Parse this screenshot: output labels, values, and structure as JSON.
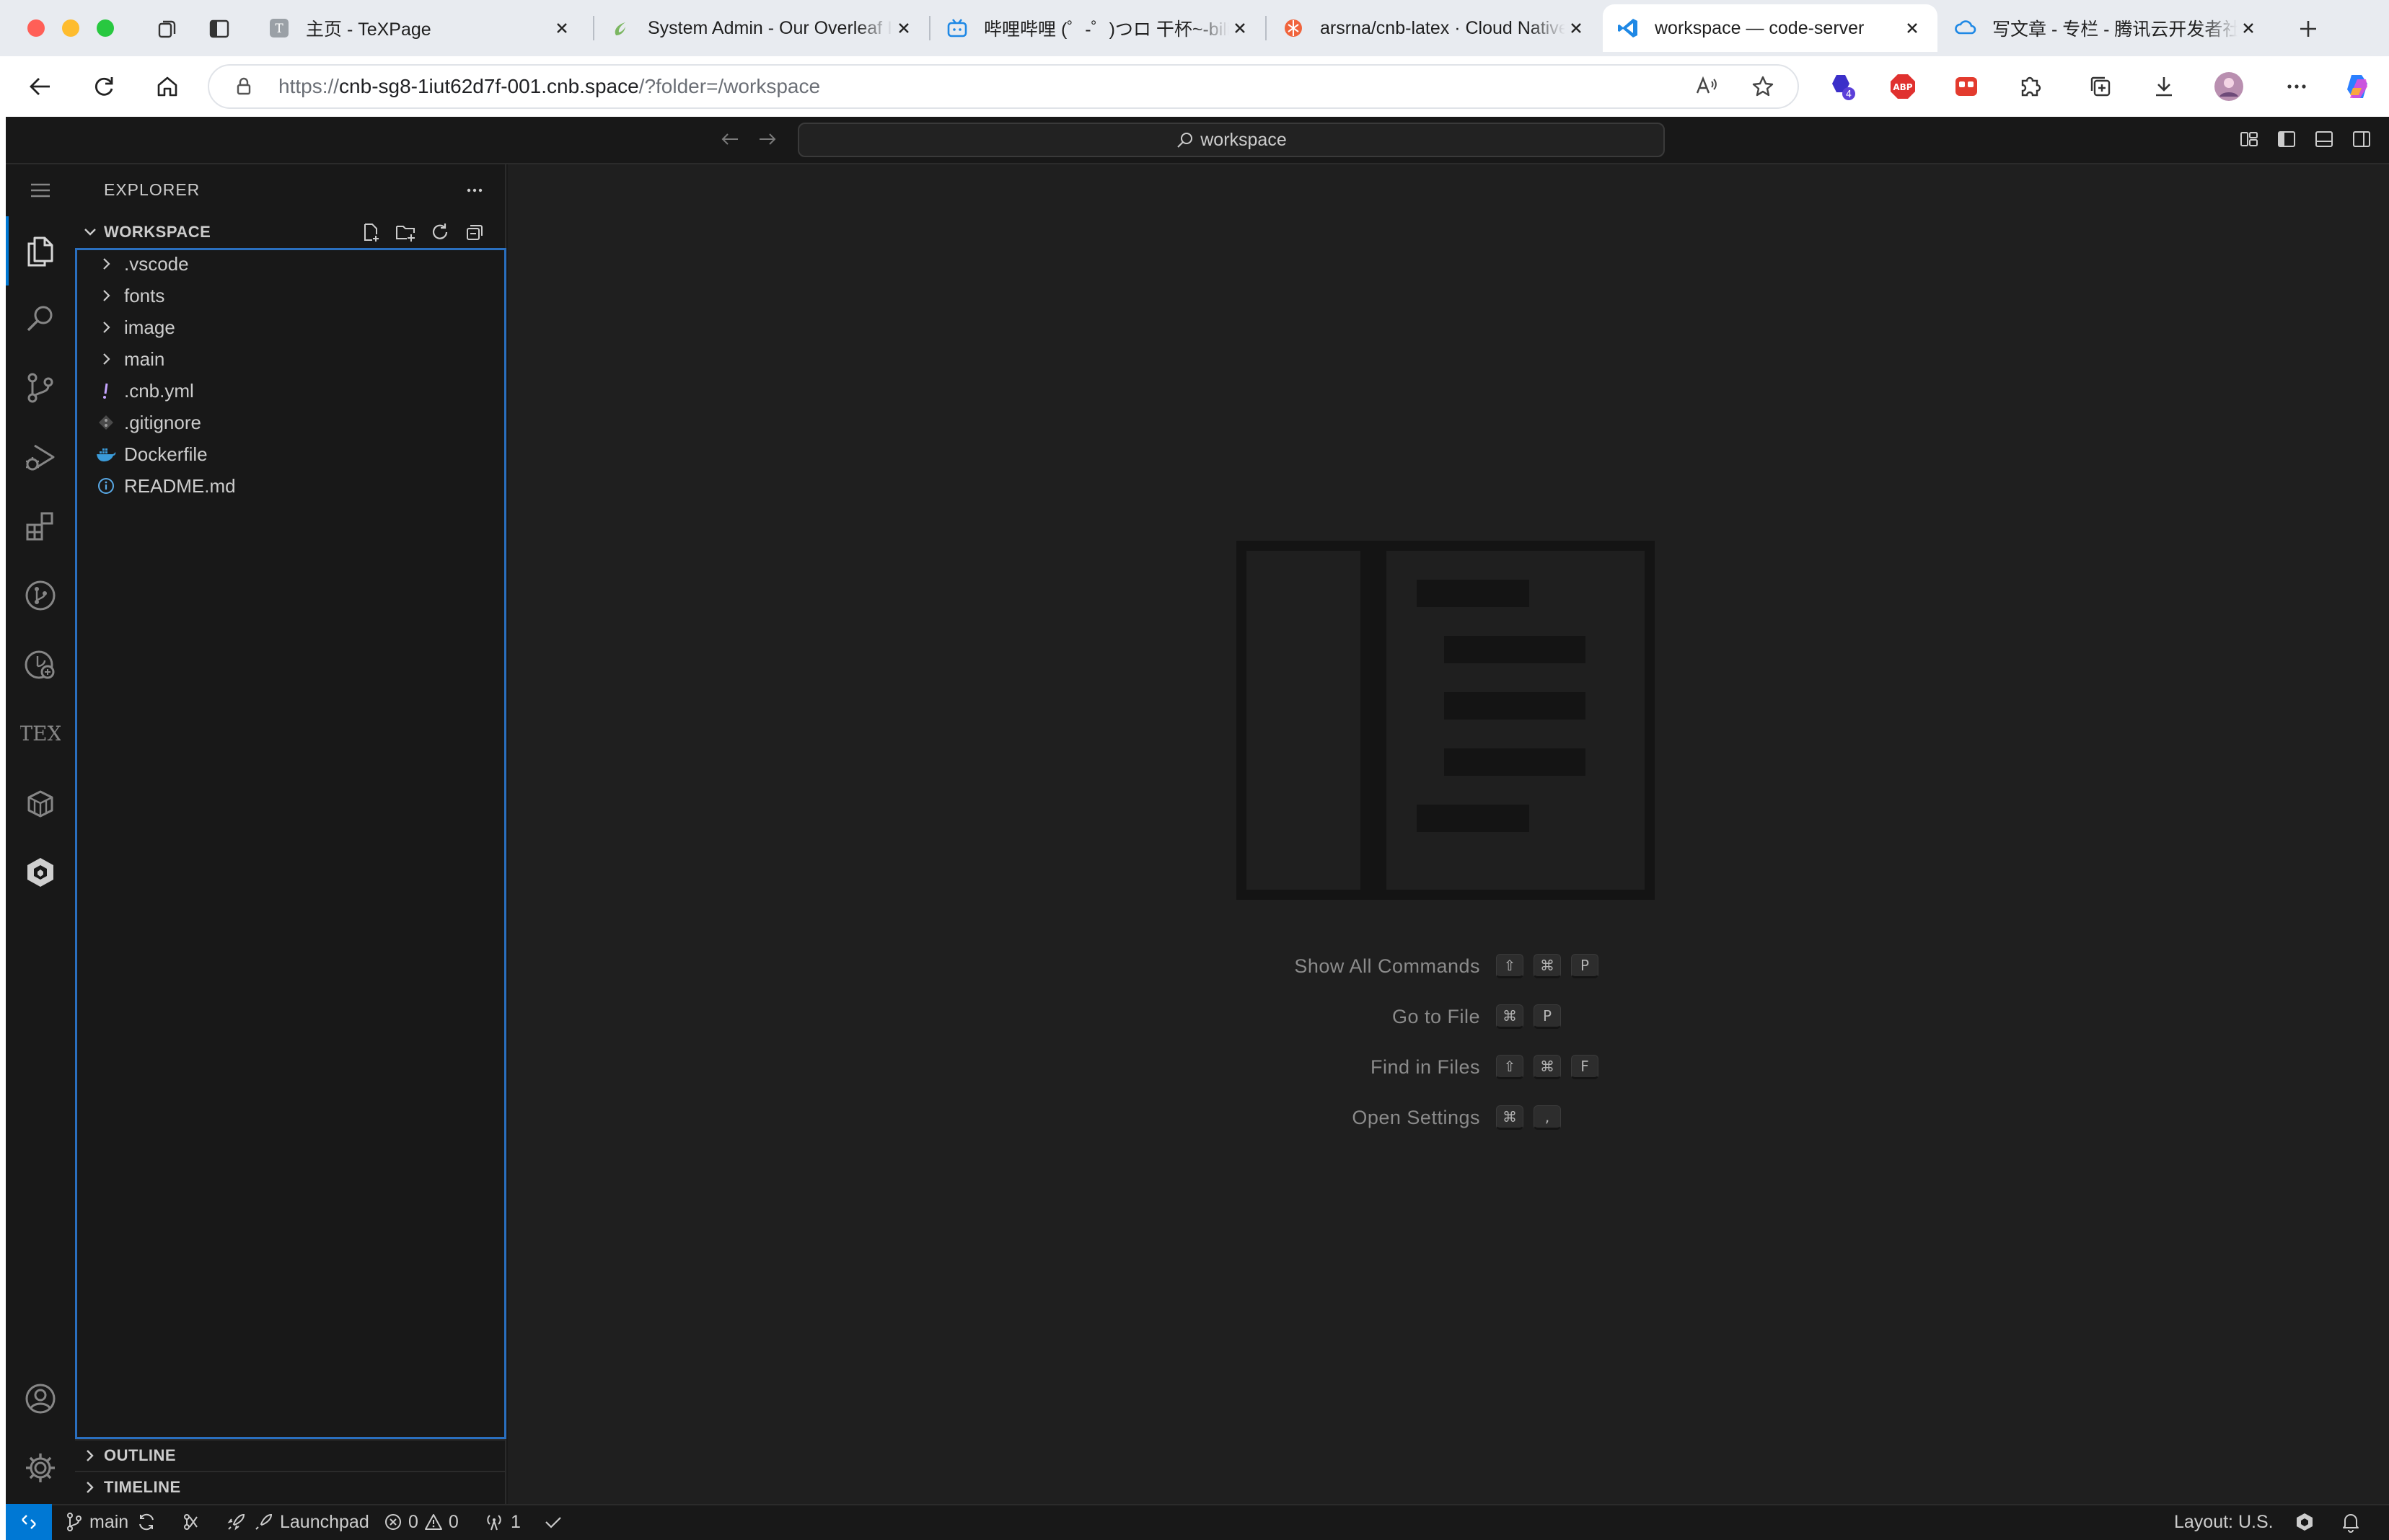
{
  "browser": {
    "tabs": [
      {
        "title": "主页 - TeXPage",
        "active": false
      },
      {
        "title": "System Admin - Our Overleaf Instance",
        "active": false
      },
      {
        "title": "哔哩哔哩 (゜-゜)つロ 干杯~-bilibili",
        "active": false
      },
      {
        "title": "arsrna/cnb-latex · Cloud Native Build",
        "active": false
      },
      {
        "title": "workspace — code-server",
        "active": true
      },
      {
        "title": "写文章 - 专栏 - 腾讯云开发者社区",
        "active": false
      }
    ],
    "url_scheme": "https://",
    "url_host": "cnb-sg8-1iut62d7f-001.cnb.space",
    "url_rest": "/?folder=/workspace",
    "extension_badge": "4",
    "abp_label": "ABP"
  },
  "vscode": {
    "command_center": "workspace",
    "explorer_title": "EXPLORER",
    "workspace_label": "WORKSPACE",
    "tree": [
      {
        "name": ".vscode",
        "kind": "folder"
      },
      {
        "name": "fonts",
        "kind": "folder"
      },
      {
        "name": "image",
        "kind": "folder"
      },
      {
        "name": "main",
        "kind": "folder"
      },
      {
        "name": ".cnb.yml",
        "kind": "yaml"
      },
      {
        "name": ".gitignore",
        "kind": "git"
      },
      {
        "name": "Dockerfile",
        "kind": "docker"
      },
      {
        "name": "README.md",
        "kind": "info"
      }
    ],
    "sections": [
      "OUTLINE",
      "TIMELINE"
    ],
    "tex_label": "TEX",
    "shortcuts": [
      {
        "label": "Show All Commands",
        "keys": [
          "⇧",
          "⌘",
          "P"
        ]
      },
      {
        "label": "Go to File",
        "keys": [
          "⌘",
          "P"
        ]
      },
      {
        "label": "Find in Files",
        "keys": [
          "⇧",
          "⌘",
          "F"
        ]
      },
      {
        "label": "Open Settings",
        "keys": [
          "⌘",
          ","
        ]
      }
    ],
    "statusbar": {
      "branch": "main",
      "launchpad": "Launchpad",
      "errors": "0",
      "warnings": "0",
      "ports": "1",
      "layout": "Layout: U.S."
    },
    "colors": {
      "accent": "#0078d4",
      "focus_border": "#2a6fbf",
      "editor_bg": "#1f1f1f",
      "sidebar_bg": "#181818"
    }
  }
}
